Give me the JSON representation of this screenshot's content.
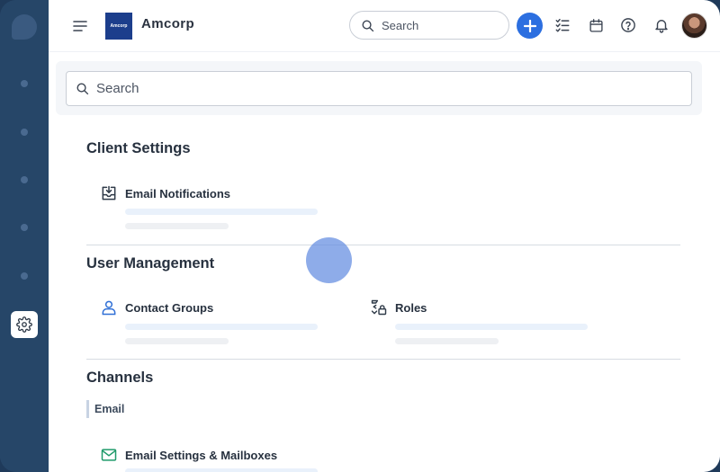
{
  "header": {
    "brand_logo_text": "Amcorp",
    "brand_name": "Amcorp",
    "search_placeholder": "Search"
  },
  "content": {
    "search_placeholder": "Search",
    "sections": {
      "client_settings": {
        "title": "Client Settings",
        "items": [
          {
            "label": "Email Notifications",
            "icon": "inbox-download-icon"
          }
        ]
      },
      "user_management": {
        "title": "User Management",
        "items": [
          {
            "label": "Contact Groups",
            "icon": "user-icon"
          },
          {
            "label": "Roles",
            "icon": "roles-lock-icon"
          }
        ]
      },
      "channels": {
        "title": "Channels",
        "tab": "Email",
        "items": [
          {
            "label": "Email Settings & Mailboxes",
            "icon": "mail-icon"
          }
        ]
      }
    }
  },
  "colors": {
    "rail": "#264668",
    "accent": "#2c6fe0",
    "brand": "#1c3e8c",
    "touch_indicator": "#628ce1"
  }
}
